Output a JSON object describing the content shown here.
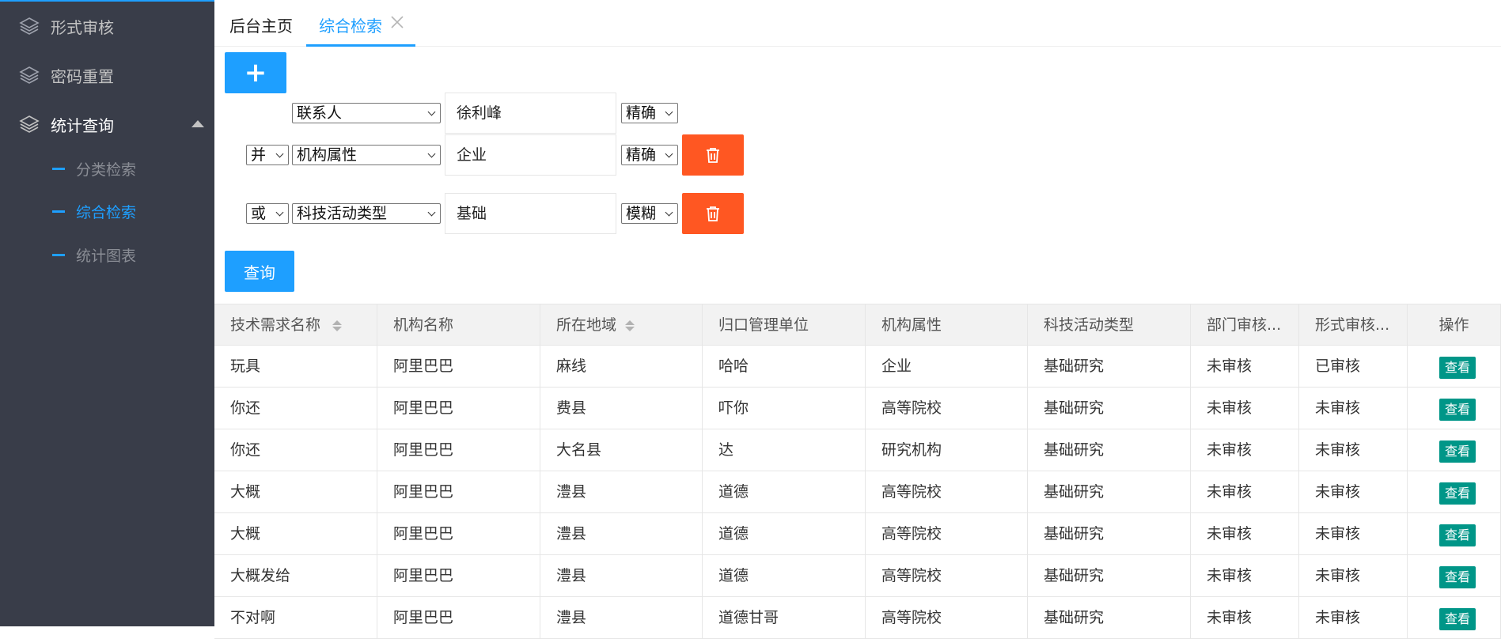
{
  "sidebar": {
    "items": [
      {
        "label": "形式审核",
        "icon": "layers-icon"
      },
      {
        "label": "密码重置",
        "icon": "layers-icon"
      },
      {
        "label": "统计查询",
        "icon": "layers-icon"
      }
    ],
    "sub_items": [
      {
        "label": "分类检索"
      },
      {
        "label": "综合检索"
      },
      {
        "label": "统计图表"
      }
    ]
  },
  "tabs": {
    "home_label": "后台主页",
    "search_label": "综合检索"
  },
  "search": {
    "add_label": "+",
    "query_label": "查询",
    "conditions": [
      {
        "logic": "",
        "field": "联系人",
        "value": "徐利峰",
        "match": "精确"
      },
      {
        "logic": "并",
        "field": "机构属性",
        "value": "企业",
        "match": "精确"
      },
      {
        "logic": "或",
        "field": "科技活动类型",
        "value": "基础",
        "match": "模糊"
      }
    ]
  },
  "table": {
    "columns": [
      "技术需求名称",
      "机构名称",
      "所在地域",
      "归口管理单位",
      "机构属性",
      "科技活动类型",
      "部门审核...",
      "形式审核...",
      "操作"
    ],
    "rows": [
      [
        "玩具",
        "阿里巴巴",
        "麻线",
        "哈哈",
        "企业",
        "基础研究",
        "未审核",
        "已审核"
      ],
      [
        "你还",
        "阿里巴巴",
        "费县",
        "吓你",
        "高等院校",
        "基础研究",
        "未审核",
        "未审核"
      ],
      [
        "你还",
        "阿里巴巴",
        "大名县",
        "达",
        "研究机构",
        "基础研究",
        "未审核",
        "未审核"
      ],
      [
        "大概",
        "阿里巴巴",
        "澧县",
        "道德",
        "高等院校",
        "基础研究",
        "未审核",
        "未审核"
      ],
      [
        "大概",
        "阿里巴巴",
        "澧县",
        "道德",
        "高等院校",
        "基础研究",
        "未审核",
        "未审核"
      ],
      [
        "大概发给",
        "阿里巴巴",
        "澧县",
        "道德",
        "高等院校",
        "基础研究",
        "未审核",
        "未审核"
      ],
      [
        "不对啊",
        "阿里巴巴",
        "澧县",
        "道德甘哥",
        "高等院校",
        "基础研究",
        "未审核",
        "未审核"
      ]
    ],
    "action_label": "查看"
  },
  "colors": {
    "sidebar_bg": "#393d49",
    "accent": "#1e9fff",
    "danger": "#ff5722",
    "view_button": "#009688"
  }
}
